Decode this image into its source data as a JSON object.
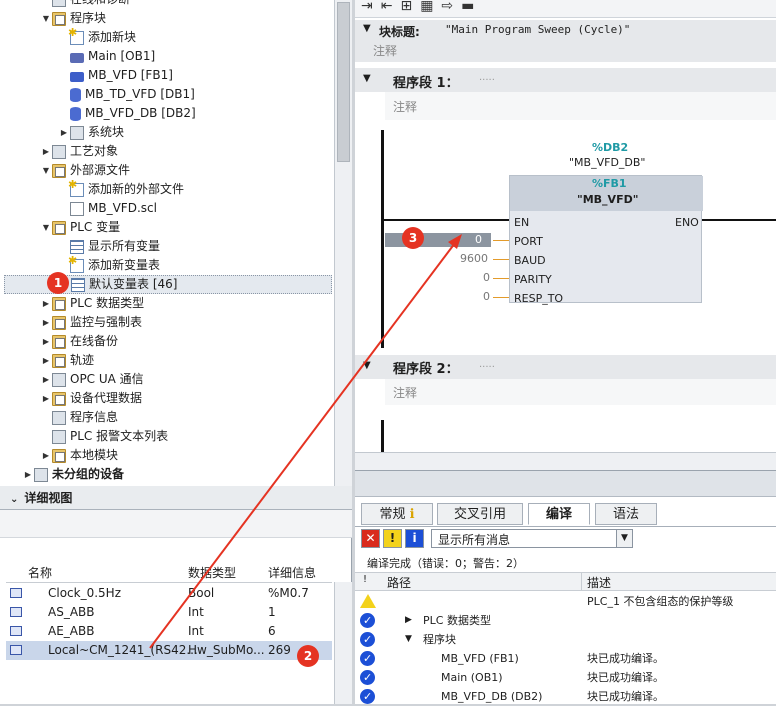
{
  "tree": {
    "items": [
      {
        "label": "在线和诊断",
        "indent": 1,
        "icon": "online-diagnostics-icon",
        "arrow": ""
      },
      {
        "label": "程序块",
        "indent": 1,
        "icon": "folder-icon",
        "arrow": "▼"
      },
      {
        "label": "添加新块",
        "indent": 2,
        "icon": "add-new-icon",
        "arrow": ""
      },
      {
        "label": "Main [OB1]",
        "indent": 2,
        "icon": "ob-block-icon",
        "arrow": ""
      },
      {
        "label": "MB_VFD [FB1]",
        "indent": 2,
        "icon": "fb-block-icon",
        "arrow": ""
      },
      {
        "label": "MB_TD_VFD [DB1]",
        "indent": 2,
        "icon": "db-block-icon",
        "arrow": ""
      },
      {
        "label": "MB_VFD_DB [DB2]",
        "indent": 2,
        "icon": "db-block-icon",
        "arrow": ""
      },
      {
        "label": "系统块",
        "indent": 2,
        "icon": "system-blocks-icon",
        "arrow": "▶"
      },
      {
        "label": "工艺对象",
        "indent": 1,
        "icon": "technology-objects-icon",
        "arrow": "▶"
      },
      {
        "label": "外部源文件",
        "indent": 1,
        "icon": "folder-icon",
        "arrow": "▼"
      },
      {
        "label": "添加新的外部文件",
        "indent": 2,
        "icon": "add-new-icon",
        "arrow": ""
      },
      {
        "label": "MB_VFD.scl",
        "indent": 2,
        "icon": "file-icon",
        "arrow": ""
      },
      {
        "label": "PLC 变量",
        "indent": 1,
        "icon": "folder-icon",
        "arrow": "▼"
      },
      {
        "label": "显示所有变量",
        "indent": 2,
        "icon": "show-tags-icon",
        "arrow": ""
      },
      {
        "label": "添加新变量表",
        "indent": 2,
        "icon": "add-new-icon",
        "arrow": ""
      },
      {
        "label": "默认变量表 [46]",
        "indent": 2,
        "icon": "tag-table-icon",
        "arrow": "",
        "selected": true
      },
      {
        "label": "PLC 数据类型",
        "indent": 1,
        "icon": "folder-icon",
        "arrow": "▶"
      },
      {
        "label": "监控与强制表",
        "indent": 1,
        "icon": "folder-icon",
        "arrow": "▶"
      },
      {
        "label": "在线备份",
        "indent": 1,
        "icon": "folder-icon",
        "arrow": "▶"
      },
      {
        "label": "轨迹",
        "indent": 1,
        "icon": "folder-icon",
        "arrow": "▶"
      },
      {
        "label": "OPC UA 通信",
        "indent": 1,
        "icon": "opc-ua-icon",
        "arrow": "▶"
      },
      {
        "label": "设备代理数据",
        "indent": 1,
        "icon": "folder-icon",
        "arrow": "▶"
      },
      {
        "label": "程序信息",
        "indent": 1,
        "icon": "program-info-icon",
        "arrow": ""
      },
      {
        "label": "PLC 报警文本列表",
        "indent": 1,
        "icon": "text-list-icon",
        "arrow": ""
      },
      {
        "label": "本地模块",
        "indent": 1,
        "icon": "folder-icon",
        "arrow": "▶"
      },
      {
        "label": "未分组的设备",
        "indent": 0,
        "icon": "ungrouped-devices-icon",
        "arrow": "▶",
        "bold": true
      }
    ]
  },
  "detail": {
    "title": "详细视图",
    "columns": [
      "名称",
      "数据类型",
      "详细信息"
    ],
    "rows": [
      {
        "name": "Clock_0.5Hz",
        "type": "Bool",
        "info": "%M0.7"
      },
      {
        "name": "AS_ABB",
        "type": "Int",
        "info": "1"
      },
      {
        "name": "AE_ABB",
        "type": "Int",
        "info": "6"
      },
      {
        "name": "Local~CM_1241_(RS42...",
        "type": "Hw_SubMo...",
        "info": "269",
        "selected": true
      }
    ]
  },
  "editor": {
    "block_title_label": "块标题:",
    "block_title_value": "\"Main Program Sweep (Cycle)\"",
    "comment": "注释",
    "network1_label": "程序段 1：",
    "network1_dots": ".....",
    "network2_label": "程序段 2：",
    "network2_dots": ".....",
    "db_addr": "%DB2",
    "db_name": "\"MB_VFD_DB\"",
    "fb_addr": "%FB1",
    "fb_name": "\"MB_VFD\"",
    "pin_en": "EN",
    "pin_eno": "ENO",
    "pins": [
      {
        "value": "0",
        "name": "PORT"
      },
      {
        "value": "9600",
        "name": "BAUD"
      },
      {
        "value": "0",
        "name": "PARITY"
      },
      {
        "value": "0",
        "name": "RESP_TO"
      }
    ]
  },
  "info": {
    "tabs": [
      {
        "label": "常规",
        "active": false
      },
      {
        "label": "交叉引用",
        "active": false
      },
      {
        "label": "编译",
        "active": true
      },
      {
        "label": "语法",
        "active": false
      }
    ],
    "filter": "显示所有消息",
    "summary": "编译完成（错误：0；警告：2）",
    "col_path": "路径",
    "col_desc": "描述",
    "rows": [
      {
        "status": "warning",
        "path": "",
        "desc": "PLC_1 不包含组态的保护等级",
        "indent": 0,
        "arrow": ""
      },
      {
        "status": "ok",
        "path": "PLC 数据类型",
        "desc": "",
        "indent": 1,
        "arrow": "▶"
      },
      {
        "status": "ok",
        "path": "程序块",
        "desc": "",
        "indent": 1,
        "arrow": "▼"
      },
      {
        "status": "ok",
        "path": "MB_VFD (FB1)",
        "desc": "块已成功编译。",
        "indent": 2,
        "arrow": ""
      },
      {
        "status": "ok",
        "path": "Main (OB1)",
        "desc": "块已成功编译。",
        "indent": 2,
        "arrow": ""
      },
      {
        "status": "ok",
        "path": "MB_VFD_DB (DB2)",
        "desc": "块已成功编译。",
        "indent": 2,
        "arrow": ""
      }
    ]
  },
  "annotations": [
    "1",
    "2",
    "3"
  ],
  "colors": {
    "accent_red": "#e53322",
    "selection": "#c9d6ea",
    "db_teal": "#1f9aa5"
  }
}
